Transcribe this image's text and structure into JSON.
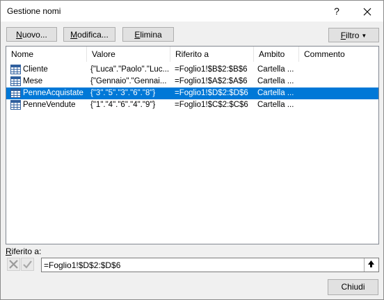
{
  "window": {
    "title": "Gestione nomi",
    "help_glyph": "?",
    "close_glyph": "✕"
  },
  "toolbar": {
    "new_label_first": "N",
    "new_label_rest": "uovo...",
    "edit_label_first": "M",
    "edit_label_rest": "odifica...",
    "delete_label_first": "E",
    "delete_label_rest": "limina",
    "filter_label_first": "F",
    "filter_label_rest": "iltro"
  },
  "table": {
    "columns": [
      "Nome",
      "Valore",
      "Riferito a",
      "Ambito",
      "Commento"
    ],
    "rows": [
      {
        "name": "Cliente",
        "value": "{\"Luca\".\"Paolo\".\"Luc...",
        "ref": "=Foglio1!$B$2:$B$6",
        "scope": "Cartella ...",
        "comment": "",
        "selected": false
      },
      {
        "name": "Mese",
        "value": "{\"Gennaio\".\"Gennai...",
        "ref": "=Foglio1!$A$2:$A$6",
        "scope": "Cartella ...",
        "comment": "",
        "selected": false
      },
      {
        "name": "PenneAcquistate",
        "value": "{\"3\".\"5\".\"3\".\"6\".\"8\"}",
        "ref": "=Foglio1!$D$2:$D$6",
        "scope": "Cartella ...",
        "comment": "",
        "selected": true
      },
      {
        "name": "PenneVendute",
        "value": "{\"1\".\"4\".\"6\".\"4\".\"9\"}",
        "ref": "=Foglio1!$C$2:$C$6",
        "scope": "Cartella ...",
        "comment": "",
        "selected": false
      }
    ]
  },
  "footer": {
    "ref_label_first": "R",
    "ref_label_rest": "iferito a:",
    "ref_value": "=Foglio1!$D$2:$D$6",
    "close_label": "Chiudi"
  },
  "colors": {
    "selection": "#0078d7",
    "grid_icon": "#2f5f9e"
  }
}
